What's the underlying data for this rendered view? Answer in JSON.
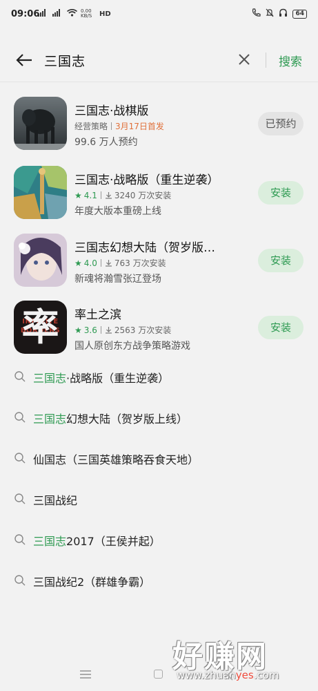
{
  "status_bar": {
    "time": "09:06",
    "net_speed": "0.00 KB/S",
    "signal_left": "4G",
    "signal_right": "4G",
    "hd_label": "HD",
    "battery": "64"
  },
  "search": {
    "query": "三国志",
    "search_label": "搜索"
  },
  "apps": [
    {
      "name": "三国志·战棋版",
      "category": "经营策略",
      "release": "3月17日首发",
      "desc": "99.6 万人预约",
      "action": "已预约"
    },
    {
      "name": "三国志·战略版（重生逆袭）",
      "rating": "4.1",
      "downloads": "3240 万次安装",
      "desc": "年度大版本重磅上线",
      "action": "安装"
    },
    {
      "name": "三国志幻想大陆（贺岁版…",
      "rating": "4.0",
      "downloads": "763 万次安装",
      "desc": "新魂将瀚雪张辽登场",
      "action": "安装"
    },
    {
      "name": "率土之滨",
      "rating": "3.6",
      "downloads": "2563 万次安装",
      "desc": "国人原创东方战争策略游戏",
      "action": "安装"
    }
  ],
  "suggestions": [
    {
      "highlight": "三国志",
      "rest": "·战略版（重生逆袭）"
    },
    {
      "highlight": "三国志",
      "rest": "幻想大陆（贺岁版上线）"
    },
    {
      "highlight": "",
      "rest": "仙国志（三国英雄策略吞食天地）"
    },
    {
      "highlight": "",
      "rest": "三国战纪"
    },
    {
      "highlight": "三国志",
      "rest": "2017（王侯并起）"
    },
    {
      "highlight": "",
      "rest": "三国战纪2（群雄争霸）"
    }
  ],
  "app4_icon_text": {
    "glyph": "率",
    "banner": "INFINITE BORDERS"
  },
  "watermark": {
    "big": "好赚网",
    "small_a": "www.zhuan",
    "small_b": "yes",
    "small_c": ".com"
  },
  "colors": {
    "accent": "#2e9a52",
    "release_date": "#e0703a",
    "background": "#f2f2f2"
  },
  "icons": [
    "back-arrow-icon",
    "clear-icon",
    "search-icon",
    "star-icon",
    "download-icon",
    "menu-icon",
    "home-icon",
    "back-nav-icon"
  ]
}
